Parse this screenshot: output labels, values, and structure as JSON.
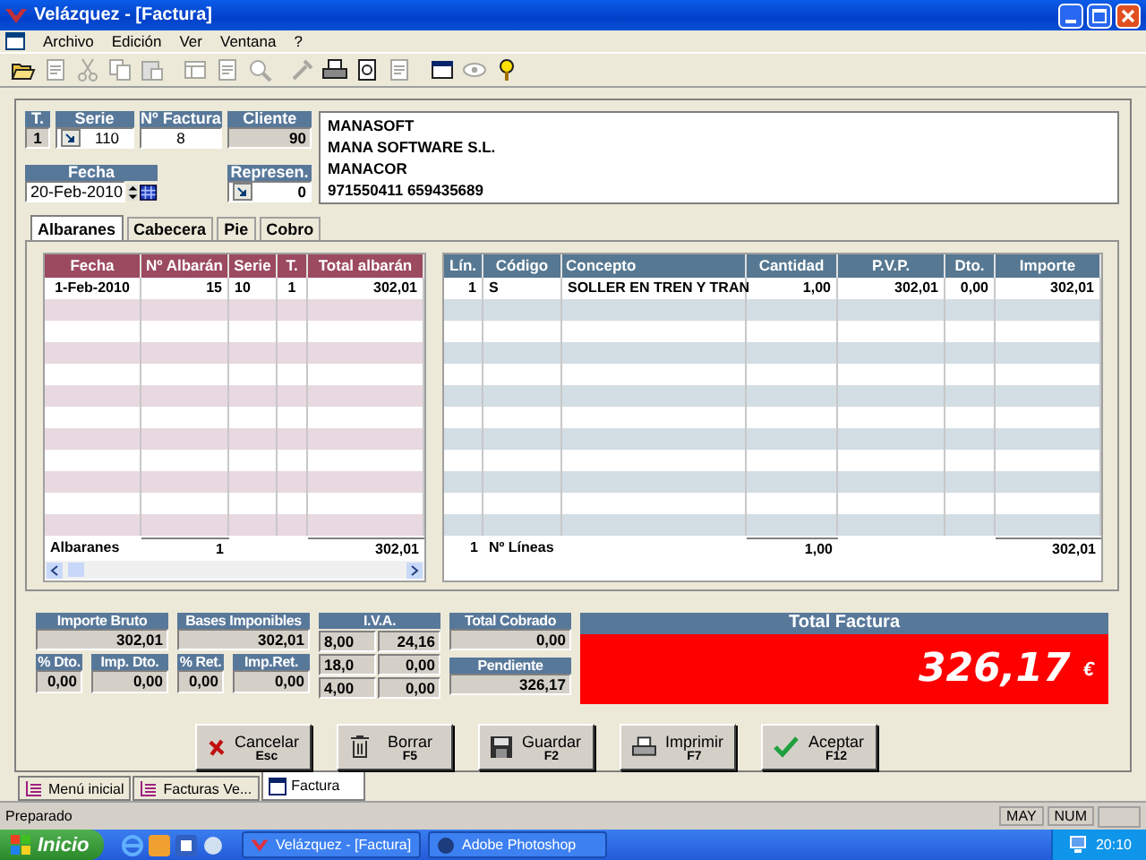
{
  "window": {
    "title": "Velázquez - [Factura]"
  },
  "menu": [
    "Archivo",
    "Edición",
    "Ver",
    "Ventana",
    "?"
  ],
  "toolbar": [
    {
      "kind": "open",
      "disabled": false
    },
    {
      "kind": "form",
      "disabled": true
    },
    {
      "kind": "cut",
      "disabled": true
    },
    {
      "kind": "copy",
      "disabled": true
    },
    {
      "kind": "paste",
      "disabled": true
    },
    {
      "kind": "sep"
    },
    {
      "kind": "table",
      "disabled": true
    },
    {
      "kind": "form",
      "disabled": true
    },
    {
      "kind": "find",
      "disabled": true
    },
    {
      "kind": "sep"
    },
    {
      "kind": "tools",
      "disabled": true
    },
    {
      "kind": "print",
      "disabled": false
    },
    {
      "kind": "preview",
      "disabled": false
    },
    {
      "kind": "page",
      "disabled": true
    },
    {
      "kind": "sep"
    },
    {
      "kind": "window",
      "disabled": false
    },
    {
      "kind": "view",
      "disabled": true
    },
    {
      "kind": "help",
      "disabled": false
    }
  ],
  "header": {
    "t": {
      "label": "T.",
      "value": "1"
    },
    "serie": {
      "label": "Serie",
      "value": "110"
    },
    "numero": {
      "label": "Nº Factura",
      "value": "8"
    },
    "cliente": {
      "label": "Cliente",
      "value": "90"
    },
    "fecha": {
      "label": "Fecha",
      "value": "20-Feb-2010"
    },
    "represen": {
      "label": "Represen.",
      "value": "0"
    },
    "client_info": [
      "MANASOFT",
      "MANA SOFTWARE S.L.",
      "MANACOR",
      "971550411 659435689"
    ]
  },
  "tabs": [
    {
      "label": "Albaranes",
      "selected": true
    },
    {
      "label": "Cabecera",
      "selected": false
    },
    {
      "label": "Pie",
      "selected": false
    },
    {
      "label": "Cobro",
      "selected": false
    }
  ],
  "albaranes": {
    "columns": [
      "Fecha",
      "Nº Albarán",
      "Serie",
      "T.",
      "Total albarán"
    ],
    "rows": [
      [
        "1-Feb-2010",
        "15",
        "10",
        "1",
        "302,01"
      ]
    ],
    "footer": {
      "label": "Albaranes",
      "count": "1",
      "total": "302,01"
    }
  },
  "lineas": {
    "columns": [
      "Lín.",
      "Código",
      "Concepto",
      "Cantidad",
      "P.V.P.",
      "Dto.",
      "Importe"
    ],
    "rows": [
      [
        "1",
        "S",
        "SOLLER EN TREN Y TRAN",
        "1,00",
        "302,01",
        "0,00",
        "302,01"
      ]
    ],
    "footer": {
      "count": "1",
      "label": "Nº Líneas",
      "cantidad": "1,00",
      "importe": "302,01"
    }
  },
  "totals": {
    "importe_bruto": {
      "label": "Importe Bruto",
      "value": "302,01"
    },
    "pct_dto": {
      "label": "% Dto.",
      "value": "0,00"
    },
    "imp_dto": {
      "label": "Imp. Dto.",
      "value": "0,00"
    },
    "bases": {
      "label": "Bases Imponibles",
      "value": "302,01"
    },
    "pct_ret": {
      "label": "% Ret.",
      "value": "0,00"
    },
    "imp_ret": {
      "label": "Imp.Ret.",
      "value": "0,00"
    },
    "iva": {
      "label": "I.V.A.",
      "rows": [
        [
          "8,00",
          "24,16"
        ],
        [
          "18,0",
          "0,00"
        ],
        [
          "4,00",
          "0,00"
        ]
      ]
    },
    "cobrado": {
      "label": "Total Cobrado",
      "value": "0,00"
    },
    "pendiente": {
      "label": "Pendiente",
      "value": "326,17"
    },
    "total_factura": {
      "label": "Total Factura",
      "value": "326,17",
      "currency": "€"
    }
  },
  "buttons": [
    {
      "kind": "cancel",
      "label": "Cancelar",
      "key": "Esc"
    },
    {
      "kind": "delete",
      "label": "Borrar",
      "key": "F5"
    },
    {
      "kind": "save",
      "label": "Guardar",
      "key": "F2"
    },
    {
      "kind": "print",
      "label": "Imprimir",
      "key": "F7"
    },
    {
      "kind": "accept",
      "label": "Aceptar",
      "key": "F12"
    }
  ],
  "mdi_tabs": [
    {
      "label": "Menú inicial",
      "selected": false
    },
    {
      "label": "Facturas Ve...",
      "selected": false
    },
    {
      "label": "Factura",
      "selected": true
    }
  ],
  "status_bar": {
    "text": "Preparado",
    "indicators": [
      "MAY",
      "NUM"
    ]
  },
  "taskbar": {
    "start": "Inicio",
    "tasks": [
      "Velázquez - [Factura]",
      "Adobe Photoshop"
    ],
    "clock": "20:10"
  }
}
